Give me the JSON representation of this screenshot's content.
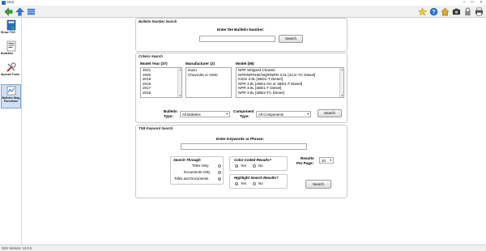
{
  "window": {
    "title": "ISIS"
  },
  "sidebar": {
    "items": [
      {
        "label": "Show TOC"
      },
      {
        "label": "Bulletins"
      },
      {
        "label": "Special Tools"
      },
      {
        "label": "Bulletin Diag Functions"
      }
    ]
  },
  "bulletin_search": {
    "panel_title": "Bulletin Number Search",
    "heading": "Enter the Bulletin Number:",
    "input_value": "",
    "button": "Search"
  },
  "criteria_search": {
    "panel_title": "Criteria Search",
    "model_year_header": "Model Year (37)",
    "model_years": [
      "2021",
      "2020",
      "2019",
      "2018",
      "2017",
      "2016"
    ],
    "manufacturer_header": "Manufacturer (2)",
    "manufacturers": [
      "Isuzu",
      "Chevrolet or GMC"
    ],
    "model_header": "Model (89)",
    "models": [
      "NPR Stripped Chassis",
      "NPR/NPRHD/NQR/NRR 3.0L [4JJ1-TC Diesel]",
      "KS22 3.9L [4BD1-T Diesel]",
      "NPR 3.9L [4BD1-NA or 4BD1-T Diesel]",
      "NPR 3.9L [4BD1-T Diesel]",
      "NPR 3.9L [4BD2-TC Diesel]"
    ],
    "bulletin_type_label": "Bulletin\nType:",
    "bulletin_type_label_1": "Bulletin",
    "bulletin_type_label_2": "Type:",
    "bulletin_type_value": "All Bulletins",
    "component_type_label_1": "Component",
    "component_type_label_2": "Type:",
    "component_type_value": "All Components",
    "button": "Search"
  },
  "keyword_search": {
    "panel_title": "TSB Keyword Search",
    "heading": "Enter Keywords or Phrase:",
    "input_value": "",
    "search_through_title": "Search Through",
    "search_through_options": [
      {
        "label": "Titles Only",
        "selected": false
      },
      {
        "label": "Documents Only",
        "selected": false
      },
      {
        "label": "Titles and Documents",
        "selected": true
      }
    ],
    "color_coded_title": "Color Coded Results?",
    "color_coded_yes": "Yes",
    "color_coded_no": "No",
    "highlight_title": "Highlight Search Results?",
    "highlight_yes": "Yes",
    "highlight_no": "No",
    "results_per_page_label_1": "Results",
    "results_per_page_label_2": "Per Page:",
    "results_per_page_value": "20",
    "button": "Search"
  },
  "status": {
    "version": "ISIS Version: 12.0.5"
  },
  "colors": {
    "accent": "#2a6fc9",
    "toolbar": "#f0f0f0",
    "panel_border": "#c8c8c8"
  }
}
